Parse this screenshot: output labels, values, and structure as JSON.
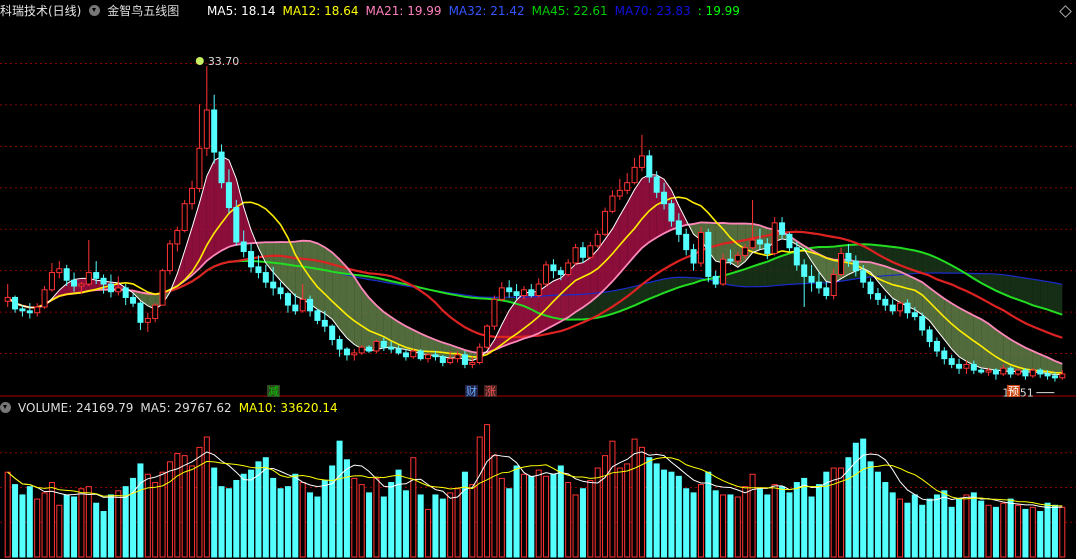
{
  "header": {
    "stock_title": "科瑞技术(日线)",
    "indicator_name": "金智鸟五线图",
    "values": [
      {
        "label": "MA5: 18.14",
        "color": "#ffffff"
      },
      {
        "label": "MA12: 18.64",
        "color": "#ffff00"
      },
      {
        "label": "MA21: 19.99",
        "color": "#ff80c0"
      },
      {
        "label": "MA32: 21.42",
        "color": "#3355ff"
      },
      {
        "label": "MA45: 22.61",
        "color": "#00cc00"
      },
      {
        "label": "MA70: 23.83",
        "color": "#1111dd"
      },
      {
        "label": ": 19.99",
        "color": "#00ff00"
      }
    ]
  },
  "volume_header": {
    "volume": "VOLUME: 24169.79",
    "ma5": "MA5: 29767.62",
    "ma10": "MA10: 33620.14"
  },
  "markers": [
    {
      "text": "减",
      "color": "#00cc00",
      "bg": "#334422"
    },
    {
      "text": "财",
      "color": "#66aaff",
      "bg": "#222244"
    },
    {
      "text": "涨",
      "color": "#ff5555",
      "bg": "#442222"
    },
    {
      "text": "预",
      "color": "#ffffff",
      "bg": "#cc4411"
    }
  ],
  "colors": {
    "up": "#ff3333",
    "down": "#54ffff",
    "grid": "#8b0000"
  },
  "icons": {
    "apple": "apple-icon",
    "dropdown": "chevron-down-icon",
    "diamond": "diamond-icon"
  },
  "chart_data": {
    "type": "candlestick",
    "price_range": [
      16.5,
      36
    ],
    "high_label": "33.70",
    "low_label": "17.51",
    "candles": [
      [
        21.4,
        22.3,
        21.1,
        21.6
      ],
      [
        21.6,
        21.7,
        20.8,
        21.0
      ],
      [
        21.0,
        21.2,
        20.6,
        20.9
      ],
      [
        20.9,
        21.3,
        20.5,
        20.8
      ],
      [
        20.8,
        21.3,
        20.6,
        21.1
      ],
      [
        21.1,
        22.2,
        21.0,
        22.0
      ],
      [
        22.0,
        23.4,
        21.9,
        22.9
      ],
      [
        22.9,
        23.5,
        22.6,
        23.1
      ],
      [
        23.1,
        23.3,
        22.2,
        22.5
      ],
      [
        22.5,
        22.9,
        21.9,
        22.2
      ],
      [
        22.2,
        22.4,
        21.8,
        22.3
      ],
      [
        22.3,
        24.6,
        22.2,
        22.9
      ],
      [
        22.9,
        23.5,
        22.3,
        22.6
      ],
      [
        22.6,
        22.8,
        21.8,
        22.3
      ],
      [
        22.3,
        22.8,
        21.6,
        21.9
      ],
      [
        21.9,
        22.7,
        21.7,
        22.1
      ],
      [
        22.1,
        22.3,
        21.2,
        21.6
      ],
      [
        21.6,
        21.8,
        21.1,
        21.3
      ],
      [
        21.3,
        21.4,
        19.9,
        20.3
      ],
      [
        20.3,
        20.8,
        19.8,
        20.5
      ],
      [
        20.5,
        21.3,
        20.3,
        21.2
      ],
      [
        21.2,
        23.1,
        21.2,
        23.0
      ],
      [
        23.0,
        24.6,
        22.8,
        24.4
      ],
      [
        24.4,
        25.3,
        24.0,
        25.1
      ],
      [
        25.1,
        26.7,
        25.0,
        26.5
      ],
      [
        26.5,
        27.7,
        26.2,
        27.3
      ],
      [
        27.3,
        31.7,
        27.1,
        29.4
      ],
      [
        29.4,
        33.7,
        29.0,
        31.4
      ],
      [
        31.4,
        32.2,
        28.6,
        29.2
      ],
      [
        29.2,
        29.6,
        27.3,
        27.6
      ],
      [
        27.6,
        28.3,
        26.0,
        26.3
      ],
      [
        26.3,
        26.7,
        24.3,
        24.5
      ],
      [
        24.5,
        25.1,
        23.7,
        24.0
      ],
      [
        24.0,
        24.4,
        22.9,
        23.2
      ],
      [
        23.2,
        23.8,
        22.6,
        22.9
      ],
      [
        22.9,
        23.3,
        22.1,
        22.4
      ],
      [
        22.4,
        23.2,
        21.7,
        22.1
      ],
      [
        22.1,
        22.4,
        21.5,
        21.8
      ],
      [
        21.8,
        21.9,
        20.8,
        21.2
      ],
      [
        21.2,
        21.8,
        20.7,
        20.9
      ],
      [
        20.9,
        22.3,
        20.8,
        21.5
      ],
      [
        21.5,
        21.7,
        20.6,
        20.9
      ],
      [
        20.9,
        21.0,
        20.2,
        20.4
      ],
      [
        20.4,
        20.9,
        19.8,
        20.1
      ],
      [
        20.1,
        20.2,
        19.1,
        19.4
      ],
      [
        19.4,
        19.6,
        18.5,
        18.9
      ],
      [
        18.9,
        19.0,
        18.3,
        18.6
      ],
      [
        18.6,
        18.9,
        18.3,
        18.7
      ],
      [
        18.7,
        19.1,
        18.6,
        19.0
      ],
      [
        19.0,
        19.1,
        18.7,
        18.8
      ],
      [
        18.8,
        19.4,
        18.7,
        19.3
      ],
      [
        19.3,
        19.5,
        18.8,
        19.0
      ],
      [
        19.0,
        19.3,
        18.7,
        18.9
      ],
      [
        18.9,
        19.1,
        18.6,
        18.7
      ],
      [
        18.7,
        18.9,
        18.3,
        18.5
      ],
      [
        18.5,
        18.9,
        18.4,
        18.8
      ],
      [
        18.8,
        18.9,
        18.3,
        18.4
      ],
      [
        18.4,
        18.7,
        18.2,
        18.6
      ],
      [
        18.6,
        18.8,
        18.3,
        18.5
      ],
      [
        18.5,
        18.6,
        18.0,
        18.2
      ],
      [
        18.2,
        18.8,
        18.1,
        18.4
      ],
      [
        18.4,
        18.8,
        18.2,
        18.6
      ],
      [
        18.6,
        18.8,
        17.9,
        18.1
      ],
      [
        18.1,
        18.5,
        17.9,
        18.2
      ],
      [
        18.2,
        19.2,
        18.1,
        19.0
      ],
      [
        19.0,
        20.2,
        18.9,
        20.1
      ],
      [
        20.1,
        21.7,
        19.9,
        21.5
      ],
      [
        21.5,
        22.4,
        21.4,
        22.1
      ],
      [
        22.1,
        22.5,
        21.6,
        21.9
      ],
      [
        21.9,
        22.3,
        21.5,
        21.7
      ],
      [
        21.7,
        22.2,
        21.5,
        22.0
      ],
      [
        22.0,
        22.3,
        21.6,
        21.7
      ],
      [
        21.7,
        22.6,
        21.6,
        22.3
      ],
      [
        22.3,
        23.5,
        22.2,
        23.3
      ],
      [
        23.3,
        23.6,
        22.6,
        23.0
      ],
      [
        23.0,
        23.2,
        22.5,
        22.8
      ],
      [
        22.8,
        23.6,
        22.7,
        23.4
      ],
      [
        23.4,
        24.4,
        23.3,
        24.2
      ],
      [
        24.2,
        24.5,
        23.4,
        23.7
      ],
      [
        23.7,
        24.5,
        23.6,
        24.3
      ],
      [
        24.3,
        25.1,
        24.2,
        24.9
      ],
      [
        24.9,
        26.3,
        24.8,
        26.1
      ],
      [
        26.1,
        27.2,
        26.0,
        26.9
      ],
      [
        26.9,
        27.8,
        26.7,
        27.2
      ],
      [
        27.2,
        28.1,
        27.0,
        27.6
      ],
      [
        27.6,
        28.9,
        27.5,
        28.4
      ],
      [
        28.4,
        30.1,
        28.2,
        29.0
      ],
      [
        29.0,
        29.3,
        27.6,
        27.9
      ],
      [
        27.9,
        28.2,
        26.8,
        27.1
      ],
      [
        27.1,
        27.6,
        26.2,
        26.5
      ],
      [
        26.5,
        26.7,
        25.3,
        25.6
      ],
      [
        25.6,
        26.0,
        24.5,
        24.9
      ],
      [
        24.9,
        25.2,
        23.8,
        24.1
      ],
      [
        24.1,
        24.4,
        23.0,
        23.4
      ],
      [
        23.4,
        25.3,
        23.2,
        25.0
      ],
      [
        25.0,
        25.2,
        22.4,
        22.7
      ],
      [
        22.7,
        23.0,
        22.1,
        22.3
      ],
      [
        22.3,
        23.9,
        22.2,
        23.6
      ],
      [
        23.6,
        24.1,
        23.3,
        23.5
      ],
      [
        23.5,
        24.0,
        23.3,
        23.8
      ],
      [
        23.8,
        24.4,
        23.6,
        24.2
      ],
      [
        24.2,
        26.7,
        24.1,
        24.6
      ],
      [
        24.6,
        25.2,
        24.1,
        24.4
      ],
      [
        24.4,
        24.7,
        23.6,
        23.9
      ],
      [
        23.9,
        25.8,
        23.8,
        25.5
      ],
      [
        25.5,
        25.8,
        24.7,
        24.9
      ],
      [
        24.9,
        25.0,
        24.0,
        24.2
      ],
      [
        24.2,
        24.5,
        23.0,
        23.3
      ],
      [
        23.3,
        23.6,
        21.1,
        22.7
      ],
      [
        22.7,
        23.3,
        21.9,
        22.4
      ],
      [
        22.4,
        22.9,
        21.8,
        22.1
      ],
      [
        22.1,
        22.4,
        21.5,
        21.7
      ],
      [
        21.7,
        23.1,
        21.5,
        22.8
      ],
      [
        22.8,
        24.2,
        22.7,
        23.9
      ],
      [
        23.9,
        24.4,
        23.2,
        23.5
      ],
      [
        23.5,
        23.8,
        22.7,
        23.0
      ],
      [
        23.0,
        23.3,
        22.1,
        22.4
      ],
      [
        22.4,
        22.6,
        21.5,
        21.8
      ],
      [
        21.8,
        22.1,
        21.2,
        21.5
      ],
      [
        21.5,
        21.7,
        20.9,
        21.2
      ],
      [
        21.2,
        21.5,
        20.7,
        20.9
      ],
      [
        20.9,
        21.4,
        20.6,
        21.3
      ],
      [
        21.3,
        21.5,
        20.5,
        20.8
      ],
      [
        20.8,
        21.1,
        20.4,
        20.6
      ],
      [
        20.6,
        20.8,
        19.6,
        19.9
      ],
      [
        19.9,
        20.1,
        19.0,
        19.3
      ],
      [
        19.3,
        19.5,
        18.5,
        18.8
      ],
      [
        18.8,
        19.0,
        18.1,
        18.4
      ],
      [
        18.4,
        18.6,
        17.9,
        18.1
      ],
      [
        18.1,
        18.4,
        17.6,
        17.9
      ],
      [
        17.9,
        18.3,
        17.6,
        18.1
      ],
      [
        18.1,
        18.3,
        17.6,
        17.8
      ],
      [
        17.8,
        17.9,
        17.6,
        17.7
      ],
      [
        17.7,
        17.9,
        17.5,
        17.8
      ],
      [
        17.8,
        17.9,
        17.3,
        17.6
      ],
      [
        17.6,
        18.1,
        17.5,
        17.9
      ],
      [
        17.9,
        18.0,
        17.4,
        17.6
      ],
      [
        17.6,
        17.9,
        17.5,
        17.8
      ],
      [
        17.8,
        17.9,
        17.3,
        17.5
      ],
      [
        17.5,
        17.9,
        17.4,
        17.8
      ],
      [
        17.8,
        17.9,
        17.4,
        17.6
      ],
      [
        17.6,
        17.8,
        17.3,
        17.5
      ],
      [
        17.5,
        17.7,
        17.2,
        17.4
      ],
      [
        17.4,
        17.8,
        17.3,
        17.6
      ]
    ],
    "volumes": [
      41,
      35,
      30,
      34,
      28,
      31,
      36,
      25,
      30,
      29,
      33,
      34,
      26,
      22,
      30,
      32,
      34,
      38,
      45,
      40,
      36,
      41,
      46,
      50,
      49,
      44,
      53,
      58,
      43,
      34,
      33,
      37,
      40,
      42,
      46,
      48,
      38,
      33,
      34,
      40,
      36,
      31,
      29,
      37,
      44,
      56,
      47,
      38,
      35,
      31,
      38,
      29,
      36,
      42,
      32,
      48,
      30,
      23,
      30,
      28,
      31,
      33,
      41,
      35,
      58,
      64,
      49,
      38,
      33,
      44,
      40,
      39,
      42,
      39,
      40,
      44,
      36,
      30,
      33,
      37,
      43,
      49,
      56,
      43,
      45,
      57,
      53,
      48,
      45,
      42,
      41,
      39,
      33,
      31,
      35,
      41,
      32,
      30,
      30,
      29,
      34,
      40,
      33,
      30,
      35,
      34,
      31,
      36,
      38,
      29,
      35,
      41,
      43,
      43,
      48,
      55,
      57,
      46,
      41,
      36,
      31,
      28,
      26,
      30,
      25,
      28,
      30,
      32,
      24,
      28,
      30,
      31,
      27,
      25,
      24,
      26,
      28,
      25,
      23,
      24,
      22,
      26,
      25,
      24
    ]
  }
}
